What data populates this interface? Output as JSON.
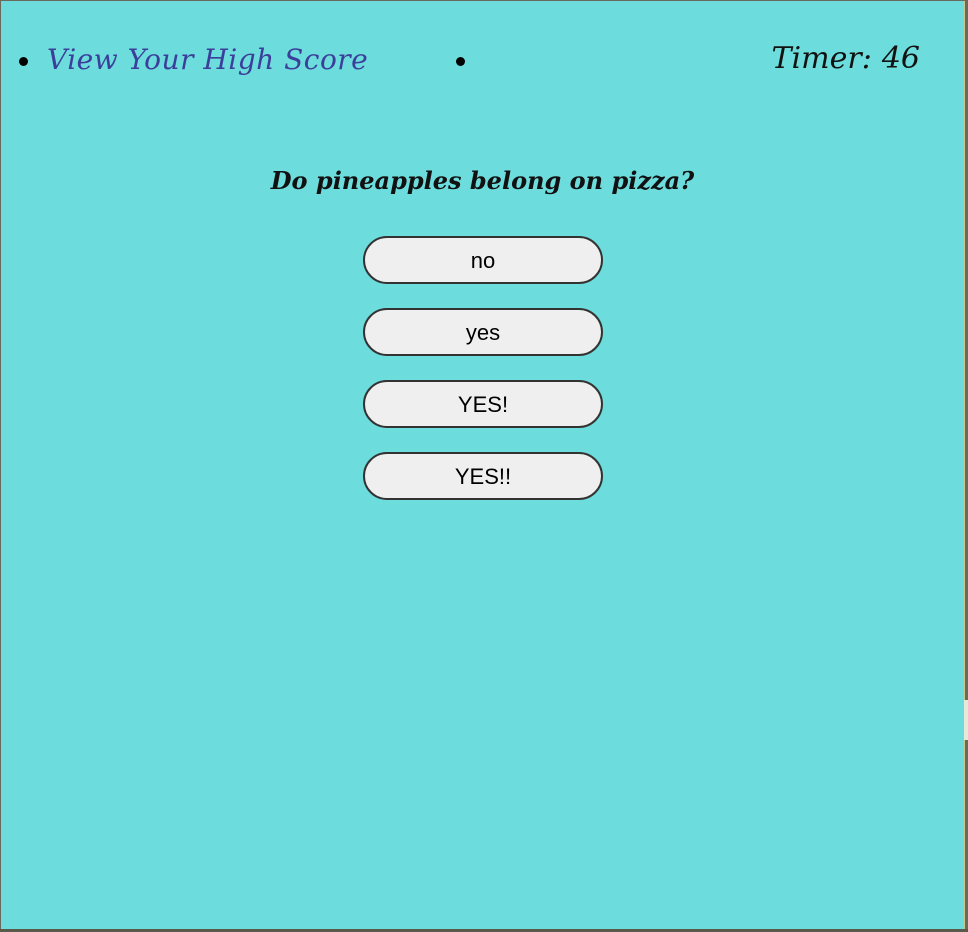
{
  "nav": {
    "high_score_link": "View Your High Score",
    "timer_label": "Timer:",
    "timer_value": "46"
  },
  "quiz": {
    "question": "Do pineapples belong on pizza?",
    "answers": [
      "no",
      "yes",
      "YES!",
      "YES!!"
    ]
  },
  "colors": {
    "background": "#6cdcdc",
    "link": "#3b3f9a",
    "button_bg": "#efefef",
    "button_border": "#333333"
  }
}
